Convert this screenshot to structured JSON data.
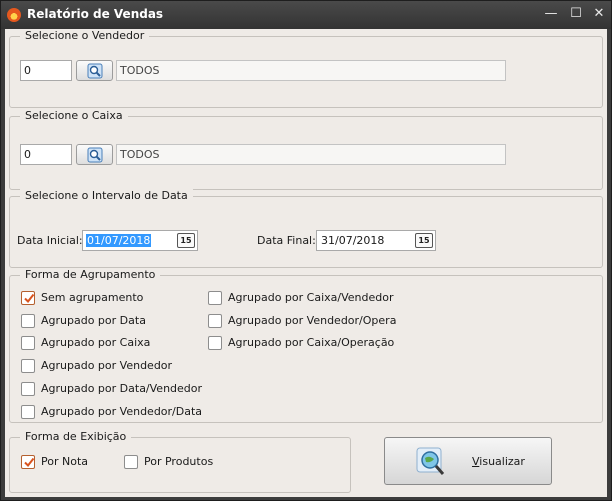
{
  "window": {
    "title": "Relatório de Vendas",
    "controls": {
      "minimize": "—",
      "maximize": "☐",
      "close": "✕"
    }
  },
  "vendedor": {
    "legend": "Selecione o Vendedor",
    "code": "0",
    "name": "TODOS"
  },
  "caixa": {
    "legend": "Selecione o Caixa",
    "code": "0",
    "name": "TODOS"
  },
  "intervalo": {
    "legend": "Selecione o Intervalo de Data",
    "start_label": "Data Inicial:",
    "start_value": "01/07/2018",
    "end_label": "Data Final:",
    "end_value": "31/07/2018",
    "calendar_glyph": "15"
  },
  "agrupamento": {
    "legend": "Forma de Agrupamento",
    "options": [
      {
        "label": "Sem agrupamento",
        "checked": true
      },
      {
        "label": "Agrupado por Data",
        "checked": false
      },
      {
        "label": "Agrupado por Caixa",
        "checked": false
      },
      {
        "label": "Agrupado por Vendedor",
        "checked": false
      },
      {
        "label": "Agrupado por Data/Vendedor",
        "checked": false
      },
      {
        "label": "Agrupado por Vendedor/Data",
        "checked": false
      },
      {
        "label": "Agrupado por Caixa/Vendedor",
        "checked": false
      },
      {
        "label": "Agrupado por Vendedor/Opera",
        "checked": false
      },
      {
        "label": "Agrupado por Caixa/Operação",
        "checked": false
      }
    ]
  },
  "exibicao": {
    "legend": "Forma de Exibição",
    "options": [
      {
        "label": "Por Nota",
        "checked": true
      },
      {
        "label": "Por Produtos",
        "checked": false
      }
    ]
  },
  "actions": {
    "visualizar_mnemonic": "V",
    "visualizar_rest": "isualizar"
  },
  "colors": {
    "titlebar": "#3a3a3a",
    "panel": "#efebe7",
    "selection": "#3399ff",
    "check_accent": "#d9531e"
  },
  "icons": {
    "app": "flame-icon",
    "lookup": "magnifier-icon",
    "calendar": "calendar-icon",
    "visualizar": "globe-magnifier-icon"
  }
}
